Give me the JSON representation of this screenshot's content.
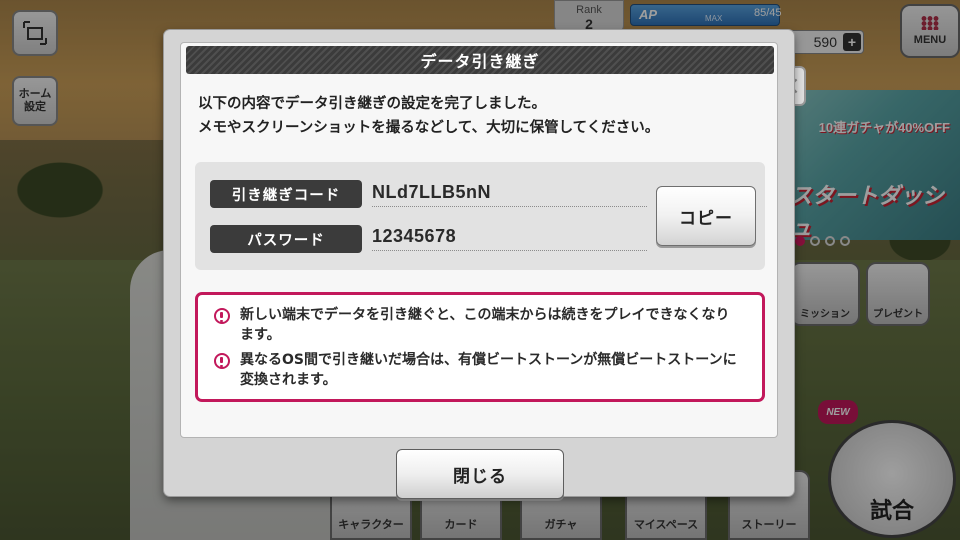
{
  "background": {
    "home_button_label": "ホーム\n設定",
    "rank_label": "Rank",
    "rank_value": "2",
    "ap_label": "AP",
    "ap_max_label": "MAX",
    "ap_value": "85/45",
    "coins": "590",
    "coin_plus": "+",
    "menu_label": "MENU",
    "banner_line1": "10連ガチャが40%OFF",
    "banner_line2": "スタートダッシュ",
    "mission_label": "ミッション",
    "present_label": "プレゼント",
    "tabs": [
      "キャラクター",
      "カード",
      "ガチャ",
      "マイスペース",
      "ストーリー"
    ],
    "new_badge": "NEW",
    "match_label": "試合"
  },
  "modal": {
    "title": "データ引き継ぎ",
    "intro_line1": "以下の内容でデータ引き継ぎの設定を完了しました。",
    "intro_line2": "メモやスクリーンショットを撮るなどして、大切に保管してください。",
    "code_label": "引き継ぎコード",
    "code_value": "NLd7LLB5nN",
    "password_label": "パスワード",
    "password_value": "12345678",
    "copy_button": "コピー",
    "warning1": "新しい端末でデータを引き継ぐと、この端末からは続きをプレイできなくなります。",
    "warning2": "異なるOS間で引き継いだ場合は、有償ビートストーンが無償ビートストーンに変換されます。",
    "close_button": "閉じる",
    "close_x": "×"
  },
  "colors": {
    "accent": "#c2185b",
    "header_bg": "#3b3b3b"
  }
}
